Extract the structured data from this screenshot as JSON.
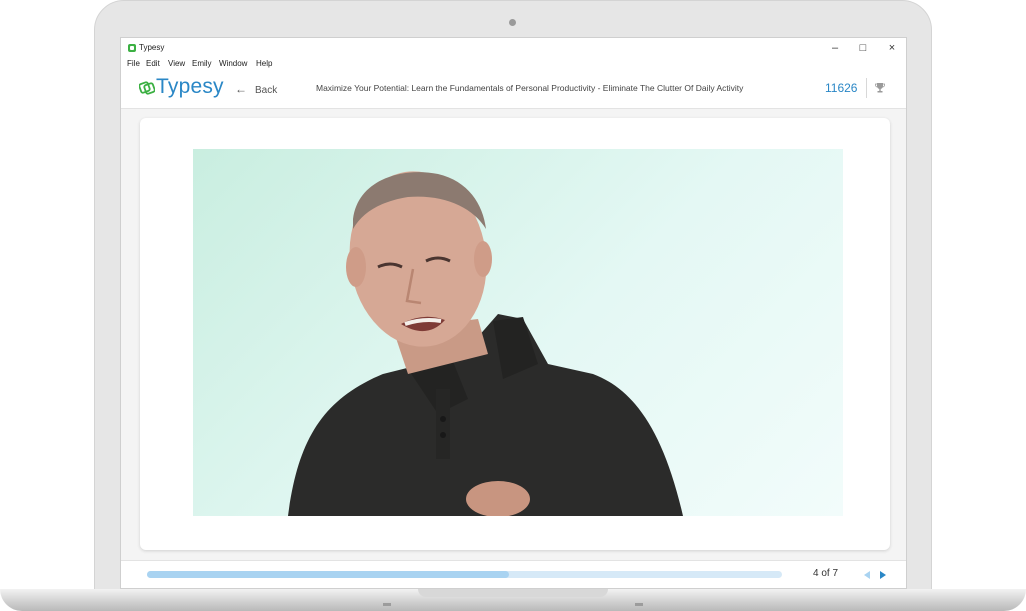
{
  "window": {
    "title": "Typesy",
    "controls": {
      "minimize_icon": "minimize-icon",
      "maximize_icon": "maximize-icon",
      "close_icon": "close-icon"
    }
  },
  "menu": [
    {
      "label": "File"
    },
    {
      "label": "Edit"
    },
    {
      "label": "View"
    },
    {
      "label": "Emily"
    },
    {
      "label": "Window"
    },
    {
      "label": "Help"
    }
  ],
  "header": {
    "logo_text": "Typesy",
    "back_label": "Back",
    "lesson_title": "Maximize Your Potential: Learn the Fundamentals of Personal Productivity - Eliminate The Clutter Of Daily Activity",
    "points": "11626",
    "trophy_icon": "trophy-icon"
  },
  "video": {
    "subject": "presenter-video"
  },
  "footer": {
    "progress": 0.57,
    "page_indicator": "4 of 7",
    "prev_icon": "prev-arrow-icon",
    "next_icon": "next-arrow-icon"
  },
  "colors": {
    "brand": "#2a87c6",
    "progress_fill": "#a9d3f1",
    "progress_track": "#d6e9f7",
    "logo_green": "#3cb043"
  }
}
